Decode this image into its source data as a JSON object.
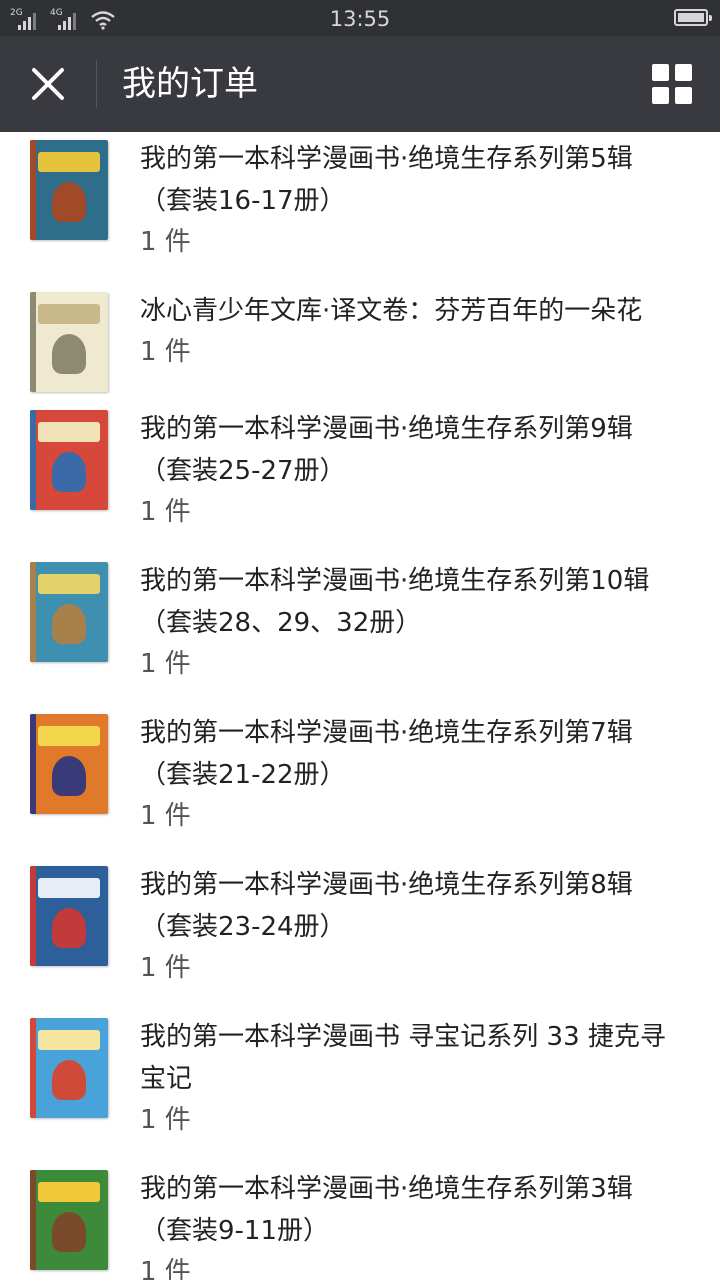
{
  "status_bar": {
    "network_1": "2G",
    "network_2": "4G",
    "time": "13:55"
  },
  "nav": {
    "title": "我的订单",
    "close_icon": "close-icon",
    "menu_icon": "grid-icon"
  },
  "orders": [
    {
      "title_line1": "我的第一本科学漫画书·绝境生存系列第5辑",
      "title_line2": "（套装16-17册）",
      "quantity": "1 件",
      "cover_colors": [
        "#2f6e8a",
        "#e5c33a",
        "#a04a2a"
      ]
    },
    {
      "title_line1": "冰心青少年文库·译文卷：芬芳百年的一朵花",
      "title_line2": "",
      "quantity": "1 件",
      "cover_colors": [
        "#efe9cf",
        "#c9b98a",
        "#8e8a70"
      ]
    },
    {
      "title_line1": "我的第一本科学漫画书·绝境生存系列第9辑",
      "title_line2": "（套装25-27册）",
      "quantity": "1 件",
      "cover_colors": [
        "#d6483a",
        "#f2e2b8",
        "#3b6aa8"
      ]
    },
    {
      "title_line1": "我的第一本科学漫画书·绝境生存系列第10辑",
      "title_line2": "（套装28、29、32册）",
      "quantity": "1 件",
      "cover_colors": [
        "#3f8fb0",
        "#e2d26a",
        "#a7804a"
      ]
    },
    {
      "title_line1": "我的第一本科学漫画书·绝境生存系列第7辑",
      "title_line2": "（套装21-22册）",
      "quantity": "1 件",
      "cover_colors": [
        "#e07a2a",
        "#f4d64a",
        "#3a3a78"
      ]
    },
    {
      "title_line1": "我的第一本科学漫画书·绝境生存系列第8辑",
      "title_line2": "（套装23-24册）",
      "quantity": "1 件",
      "cover_colors": [
        "#2d5f9a",
        "#e8eef6",
        "#c23a3a"
      ]
    },
    {
      "title_line1": "我的第一本科学漫画书 寻宝记系列 33 捷克寻",
      "title_line2": "宝记",
      "quantity": "1 件",
      "cover_colors": [
        "#4aa3d8",
        "#f4e6a0",
        "#d04a3a"
      ]
    },
    {
      "title_line1": "我的第一本科学漫画书·绝境生存系列第3辑",
      "title_line2": "（套装9-11册）",
      "quantity": "1 件",
      "cover_colors": [
        "#3c8a3a",
        "#f0c93a",
        "#7a4a2a"
      ]
    }
  ]
}
